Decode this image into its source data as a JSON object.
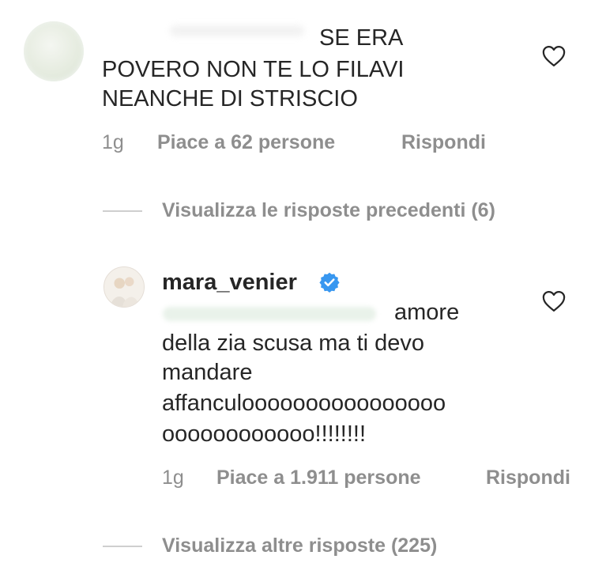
{
  "comment1": {
    "text_lines": [
      "SE ERA",
      "POVERO NON TE LO FILAVI",
      "NEANCHE DI STRISCIO"
    ],
    "time": "1g",
    "likes": "Piace a 62 persone",
    "reply_label": "Rispondi"
  },
  "view_previous_replies": "Visualizza le risposte precedenti (6)",
  "comment2": {
    "username": "mara_venier",
    "text_lines": [
      "amore",
      "della zia scusa ma ti devo",
      "mandare",
      "affanculoooooooooooooooo",
      "oooooooooooo!!!!!!!!"
    ],
    "time": "1g",
    "likes": "Piace a 1.911 persone",
    "reply_label": "Rispondi"
  },
  "view_more_replies": "Visualizza altre risposte (225)",
  "colors": {
    "text": "#262626",
    "secondary": "#8e8e8e",
    "verified": "#3897f0"
  },
  "icons": {
    "like": "heart-outline-icon",
    "verified": "verified-badge-icon"
  }
}
